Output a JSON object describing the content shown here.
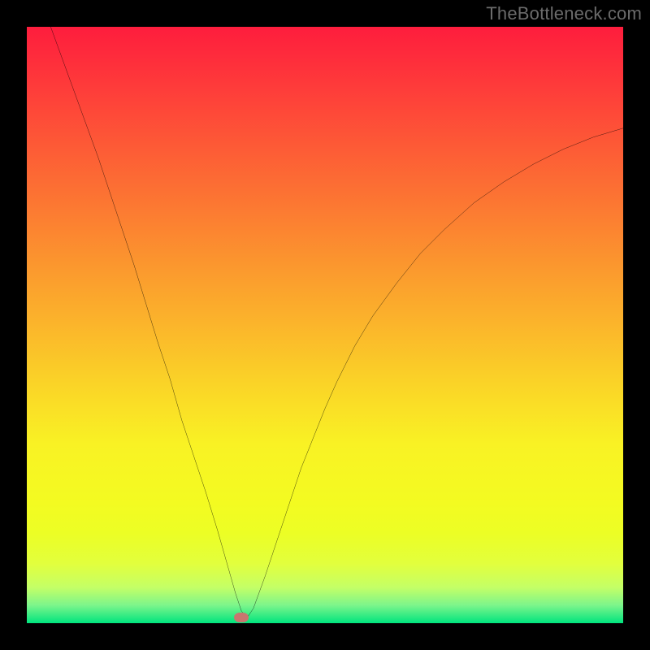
{
  "watermark": "TheBottleneck.com",
  "chart_data": {
    "type": "line",
    "title": "",
    "xlabel": "",
    "ylabel": "",
    "xlim": [
      0,
      100
    ],
    "ylim": [
      0,
      100
    ],
    "grid": false,
    "legend": false,
    "series": [
      {
        "name": "bottleneck-curve",
        "x": [
          4,
          6,
          8,
          10,
          12,
          14,
          16,
          18,
          20,
          22,
          24,
          26,
          28,
          30,
          32,
          34,
          35,
          36,
          37,
          38,
          40,
          42,
          44,
          46,
          48,
          50,
          52,
          55,
          58,
          62,
          66,
          70,
          75,
          80,
          85,
          90,
          95,
          100
        ],
        "values": [
          100,
          94.5,
          89,
          83.5,
          78,
          72,
          66,
          60,
          53.5,
          47,
          41,
          34,
          28,
          22,
          15.5,
          8.5,
          5,
          2,
          1,
          2.5,
          8,
          14,
          20,
          26,
          31,
          36,
          40.5,
          46.5,
          51.5,
          57,
          62,
          66,
          70.5,
          74,
          77,
          79.5,
          81.5,
          83
        ]
      }
    ],
    "marker": {
      "x": 36,
      "y": 1
    },
    "gradient_stops": [
      {
        "pos": 0.0,
        "color": "#fe1d3d"
      },
      {
        "pos": 0.1,
        "color": "#fe3b3a"
      },
      {
        "pos": 0.2,
        "color": "#fd5a36"
      },
      {
        "pos": 0.3,
        "color": "#fc7832"
      },
      {
        "pos": 0.4,
        "color": "#fb972e"
      },
      {
        "pos": 0.5,
        "color": "#fbb52b"
      },
      {
        "pos": 0.6,
        "color": "#fad427"
      },
      {
        "pos": 0.7,
        "color": "#f9f224"
      },
      {
        "pos": 0.8,
        "color": "#f3fb21"
      },
      {
        "pos": 0.85,
        "color": "#ecfe25"
      },
      {
        "pos": 0.9,
        "color": "#e2ff3d"
      },
      {
        "pos": 0.94,
        "color": "#c4ff66"
      },
      {
        "pos": 0.97,
        "color": "#7cf58b"
      },
      {
        "pos": 1.0,
        "color": "#00e47e"
      }
    ]
  }
}
